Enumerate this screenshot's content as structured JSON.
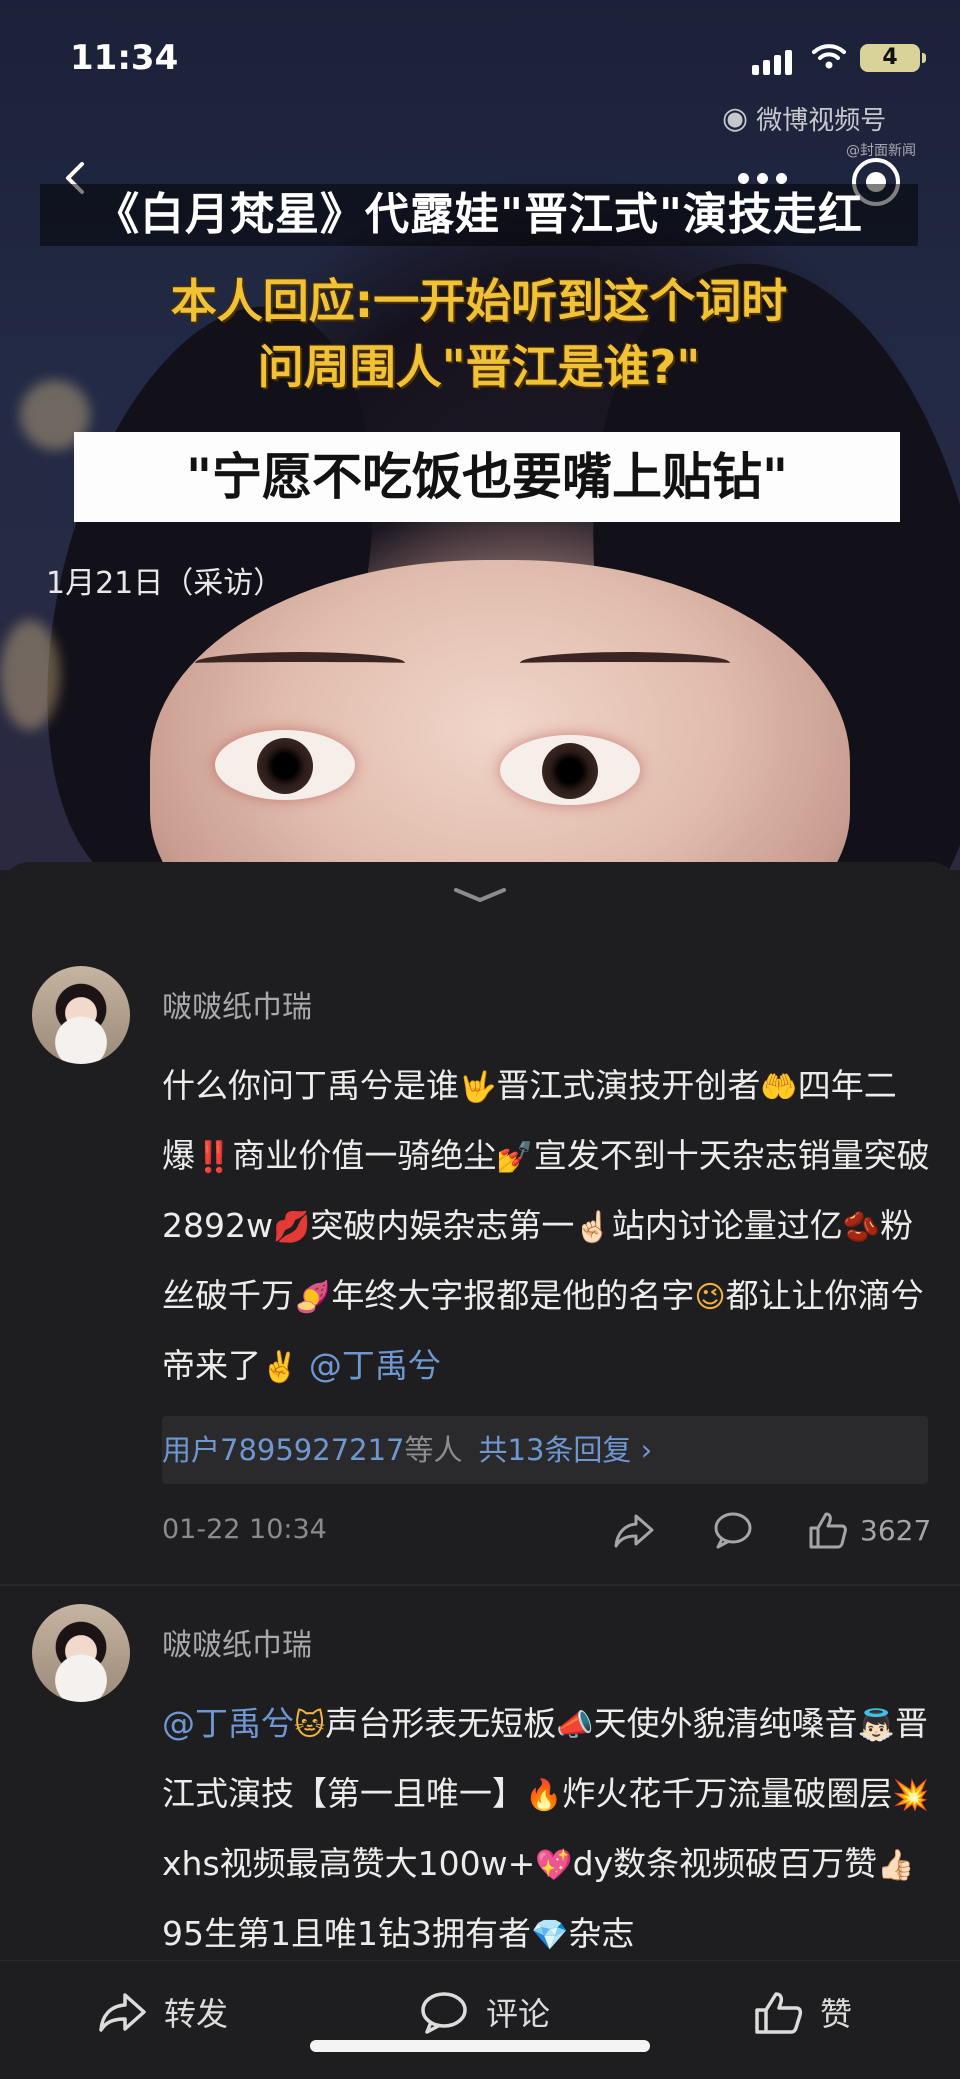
{
  "status_bar": {
    "time": "11:34",
    "battery": "4"
  },
  "video": {
    "watermark": "微博视频号",
    "watermark_sub": "@封面新闻",
    "caption_title": "《白月梵星》代露娃\"晋江式\"演技走红",
    "caption_line1": "本人回应:一开始听到这个词时",
    "caption_line2": "问周围人\"晋江是谁?\"",
    "caption_quote": "\"宁愿不吃饭也要嘴上贴钻\"",
    "caption_date": "1月21日（采访）"
  },
  "comments": [
    {
      "author": "啵啵纸巾瑞",
      "text_parts": [
        {
          "t": "什么你问丁禹兮是谁"
        },
        {
          "e": "🤟"
        },
        {
          "t": "晋江式演技开创者"
        },
        {
          "e": "🤲"
        },
        {
          "t": "四年二爆"
        },
        {
          "e": "‼️"
        },
        {
          "t": "商业价值一骑绝尘"
        },
        {
          "e": "💅"
        },
        {
          "t": "宣发不到十天杂志销量突破2892w"
        },
        {
          "e": "💋"
        },
        {
          "t": "突破内娱杂志第一"
        },
        {
          "e": "☝🏻"
        },
        {
          "t": "站内讨论量过亿"
        },
        {
          "e": "🫘"
        },
        {
          "t": "粉丝破千万"
        },
        {
          "e": "🍠"
        },
        {
          "t": "年终大字报都是他的名字"
        },
        {
          "e": "😉"
        },
        {
          "t": "都让让你滴兮帝来了"
        },
        {
          "e": "✌️"
        },
        {
          "m": " @丁禹兮"
        }
      ],
      "replies_users": "用户7895927217",
      "replies_etc": "等人",
      "replies_count": "共13条回复 ›",
      "time": "01-22 10:34",
      "likes": "3627"
    },
    {
      "author": "啵啵纸巾瑞",
      "text_parts": [
        {
          "m": "@丁禹兮"
        },
        {
          "e": "🐱"
        },
        {
          "t": "声台形表无短板"
        },
        {
          "e": "📣"
        },
        {
          "t": "天使外貌清纯嗓音"
        },
        {
          "e": "👼🏻"
        },
        {
          "t": "晋江式演技【第一且唯一】"
        },
        {
          "e": "🔥"
        },
        {
          "t": "炸火花千万流量破圈层"
        },
        {
          "e": "💥"
        },
        {
          "t": "xhs视频最高赞大100w+"
        },
        {
          "e": "💖"
        },
        {
          "t": "dy数条视频破百万赞"
        },
        {
          "e": "👍🏻"
        },
        {
          "t": "95生第1且唯1钻3拥有者"
        },
        {
          "e": "💎"
        },
        {
          "t": "杂志"
        }
      ]
    }
  ],
  "bottom_bar": {
    "repost": "转发",
    "comment": "评论",
    "like": "赞"
  },
  "colors": {
    "mention": "#6f97d1",
    "caption_yellow": "#f2c236",
    "sheet_bg": "#1e1e20"
  }
}
